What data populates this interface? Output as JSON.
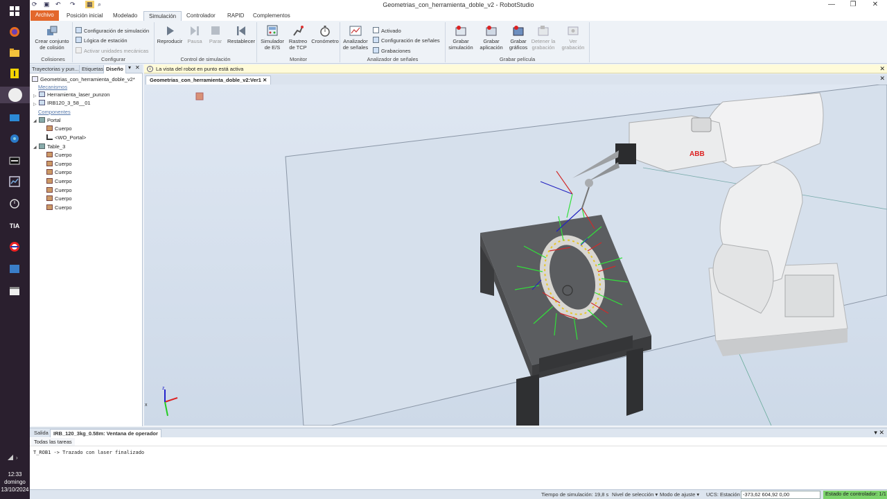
{
  "app": {
    "title": "Geometrias_con_herramienta_doble_v2 - RobotStudio"
  },
  "ribbon_tabs": [
    "Archivo",
    "Posición inicial",
    "Modelado",
    "Simulación",
    "Controlador",
    "RAPID",
    "Complementos"
  ],
  "ribbon": {
    "collisions": {
      "create": "Crear conjunto de colisión",
      "group": "Colisiones"
    },
    "configure": {
      "sim_config": "Configuración de simulación",
      "station_logic": "Lógica de estación",
      "mech_units": "Activar unidades mecánicas",
      "group": "Configurar"
    },
    "sim_control": {
      "play": "Reproducir",
      "pause": "Pausa",
      "stop": "Parar",
      "reset": "Restablecer",
      "group": "Control de simulación"
    },
    "monitor": {
      "io_sim_1": "Simulador",
      "io_sim_2": "de E/S",
      "tcp_1": "Rastreo",
      "tcp_2": "de TCP",
      "stopwatch": "Cronómetro",
      "group": "Monitor"
    },
    "signal_analyzer": {
      "analyzer_1": "Analizador",
      "analyzer_2": "de señales",
      "activated": "Activado",
      "signal_config": "Configuración de señales",
      "recordings": "Grabaciones",
      "group": "Analizador de señales"
    },
    "record": {
      "sim_1": "Grabar",
      "sim_2": "simulación",
      "app_1": "Grabar",
      "app_2": "aplicación",
      "gfx_1": "Grabar",
      "gfx_2": "gráficos",
      "stop_1": "Detener la",
      "stop_2": "grabación",
      "view_1": "Ver",
      "view_2": "grabación",
      "group": "Grabar película"
    }
  },
  "left_panel": {
    "tabs": [
      "Trayectorias y pun...",
      "Etiquetas",
      "Diseño"
    ],
    "station": "Geometrias_con_herramienta_doble_v2*",
    "mechanisms": "Mecanismos",
    "tool": "Herramienta_laser_punzon",
    "robot": "IRB120_3_58__01",
    "components": "Componentes",
    "portal": "Portal",
    "portal_children": [
      "Cuerpo",
      "<WO_Portal>"
    ],
    "table": "Table_3",
    "table_children": [
      "Cuerpo",
      "Cuerpo",
      "Cuerpo",
      "Cuerpo",
      "Cuerpo",
      "Cuerpo",
      "Cuerpo"
    ]
  },
  "info_bar": "La vista del robot en punto está activa",
  "document_tab": "Geometrias_con_herramienta_doble_v2:Ver1",
  "viewport": {
    "robot_brand": "ABB"
  },
  "output": {
    "tabs": [
      "Salida",
      "IRB_120_3kg_0.58m: Ventana de operador"
    ],
    "filter": "Todas las tareas",
    "log": "T_ROB1 -> Trazado con laser finalizado"
  },
  "status_bar": {
    "sim_time": "Tiempo de simulación: 19,8 s",
    "selection": "Nivel de selección ▾",
    "snap": "Modo de ajuste ▾",
    "ucs": "UCS: Estación",
    "ucs_value": "-373,62  604,92  0,00",
    "controller": "Estado de controlador: 1/1"
  },
  "clock": {
    "time": "12:33",
    "day": "domingo",
    "date": "13/10/2024"
  },
  "colors": {
    "file_tab": "#e3672b",
    "controller_ok": "#7bd36b",
    "info_bg": "#fffbd9"
  }
}
